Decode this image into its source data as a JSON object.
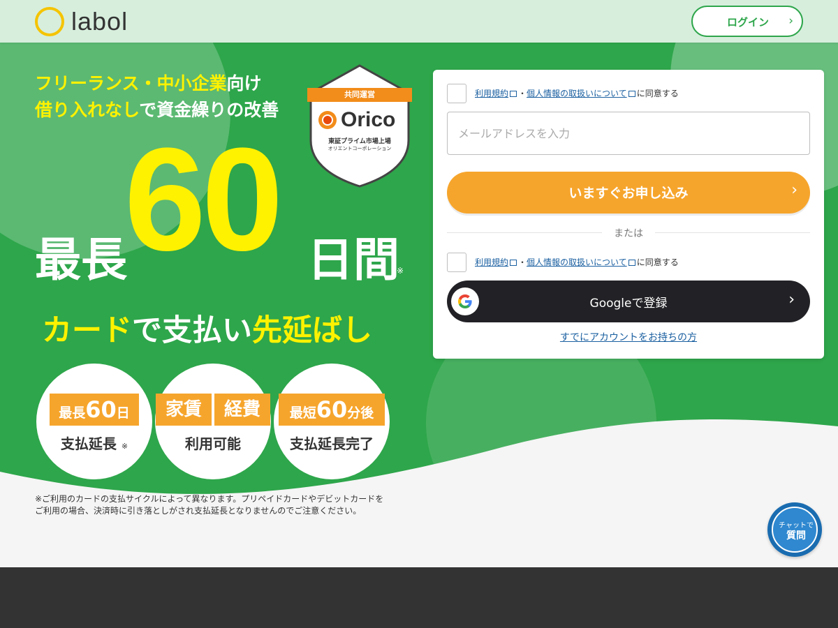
{
  "header": {
    "logo_text": "labol",
    "login_label": "ログイン"
  },
  "hero": {
    "tagline_line1_highlight": "フリーランス・中小企業",
    "tagline_line1_rest": "向け",
    "tagline_line2_highlight": "借り入れなし",
    "tagline_line2_rest": "で資金繰りの改善",
    "big_prefix": "最長",
    "big_number": "60",
    "big_suffix": "日間",
    "big_note": "※",
    "subhead_part1": "カード",
    "subhead_part2": "で支払い",
    "subhead_part3": "先延ばし",
    "badge": {
      "ribbon": "共同運営",
      "brand": "Orico",
      "line1": "東証プライム市場上場",
      "line2": "オリエントコーポレーション"
    },
    "features": [
      {
        "tag_prefix": "最長",
        "tag_number": "60",
        "tag_suffix": "日",
        "caption": "支払延長",
        "note": "※"
      },
      {
        "tag1": "家賃",
        "tag2": "経費",
        "caption": "利用可能"
      },
      {
        "tag_prefix": "最短",
        "tag_number": "60",
        "tag_suffix": "分後",
        "caption": "支払延長完了"
      }
    ],
    "disclaimer_line1": "※ご利用のカードの支払サイクルによって異なります。プリペイドカードやデビットカードを",
    "disclaimer_line2": "ご利用の場合、決済時に引き落としがされ支払延長となりませんのでご注意ください。"
  },
  "form": {
    "terms_link": "利用規約",
    "separator": "・",
    "privacy_link": "個人情報の取扱いについて",
    "agree_suffix": "に同意する",
    "email_placeholder": "メールアドレスを入力",
    "apply_label": "いますぐお申し込み",
    "or_label": "または",
    "google_label": "Googleで登録",
    "account_link": "すでにアカウントをお持ちの方"
  },
  "chat": {
    "line1": "チャットで",
    "line2": "質問"
  },
  "colors": {
    "green": "#2ea64b",
    "yellow": "#fff200",
    "orange": "#f6a52c",
    "dark_button": "#222226",
    "link": "#1a5fa0"
  },
  "icons": [
    "chevron-right-icon",
    "google-icon",
    "external-link-icon",
    "chat-icon"
  ]
}
